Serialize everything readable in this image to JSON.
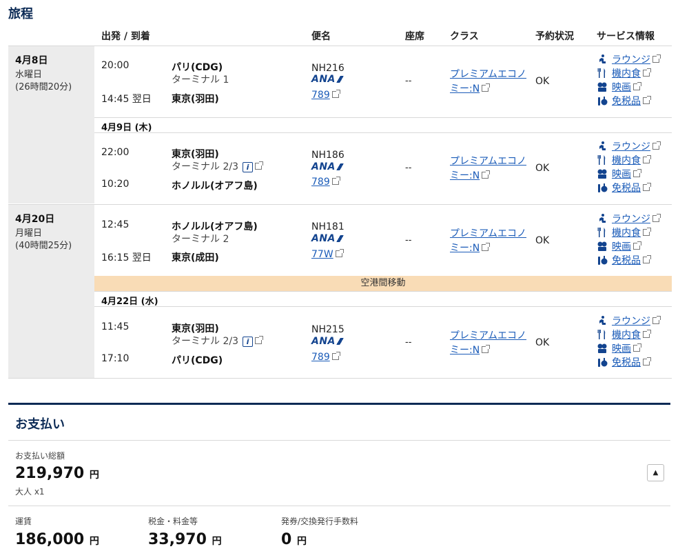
{
  "itinerary": {
    "title": "旅程",
    "headers": {
      "dep_arr": "出発 / 到着",
      "flight": "便名",
      "seat": "座席",
      "class": "クラス",
      "status": "予約状況",
      "service": "サービス情報"
    },
    "days": [
      {
        "date": "4月8日",
        "weekday": "水曜日",
        "duration": "(26時間20分)"
      },
      {
        "date": "4月20日",
        "weekday": "月曜日",
        "duration": "(40時間25分)"
      }
    ],
    "subdays": [
      "4月9日 (木)",
      "4月22日 (水)"
    ],
    "transfer": "空港間移動",
    "flights": [
      {
        "dep_time": "20:00",
        "dep_city": "パリ(CDG)",
        "dep_terminal": "ターミナル 1",
        "arr_time": "14:45 翌日",
        "arr_city": "東京(羽田)",
        "flight_no": "NH216",
        "airline": "ANA",
        "aircraft": "789",
        "seat": "--",
        "class_line1": "プレミアムエコノ",
        "class_line2": "ミー:N",
        "status": "OK"
      },
      {
        "dep_time": "22:00",
        "dep_city": "東京(羽田)",
        "dep_terminal": "ターミナル 2/3",
        "arr_time": "10:20",
        "arr_city": "ホノルル(オアフ島)",
        "flight_no": "NH186",
        "airline": "ANA",
        "aircraft": "789",
        "seat": "--",
        "class_line1": "プレミアムエコノ",
        "class_line2": "ミー:N",
        "status": "OK"
      },
      {
        "dep_time": "12:45",
        "dep_city": "ホノルル(オアフ島)",
        "dep_terminal": "ターミナル 2",
        "arr_time": "16:15 翌日",
        "arr_city": "東京(成田)",
        "flight_no": "NH181",
        "airline": "ANA",
        "aircraft": "77W",
        "seat": "--",
        "class_line1": "プレミアムエコノ",
        "class_line2": "ミー:N",
        "status": "OK"
      },
      {
        "dep_time": "11:45",
        "dep_city": "東京(羽田)",
        "dep_terminal": "ターミナル 2/3",
        "arr_time": "17:10",
        "arr_city": "パリ(CDG)",
        "flight_no": "NH215",
        "airline": "ANA",
        "aircraft": "789",
        "seat": "--",
        "class_line1": "プレミアムエコノ",
        "class_line2": "ミー:N",
        "status": "OK"
      }
    ],
    "services": [
      "ラウンジ",
      "機内食",
      "映画",
      "免税品"
    ],
    "info_icon": "i"
  },
  "payment": {
    "title": "お支払い",
    "total_label": "お支払い総額",
    "total_value": "219,970",
    "currency": "円",
    "pax": "大人 x1",
    "fare_label": "運賃",
    "fare_value": "186,000",
    "tax_label": "税金・料金等",
    "tax_value": "33,970",
    "fee_label": "発券/交換発行手数料",
    "fee_value": "0",
    "collapse_icon": "▲"
  },
  "colors": {
    "accent": "#0b2a55",
    "link": "#1a5bb8",
    "transfer_bg": "#f9dcb6"
  }
}
